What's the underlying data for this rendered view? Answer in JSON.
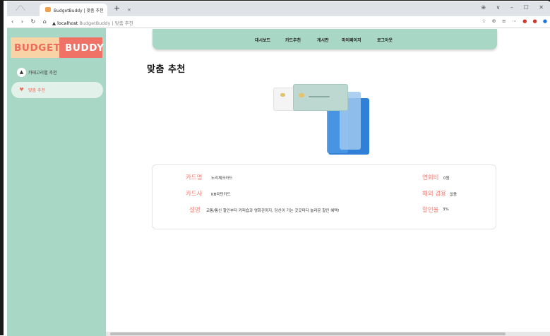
{
  "browser": {
    "tab_title": "BudgetBuddy | 맞춤 추천",
    "tab_close": "×",
    "new_tab": "+",
    "window_controls": "⊕ ∨ – ☐ ✕",
    "nav_buttons": "‹ › ↻ ⌂",
    "url_host": "localhost",
    "url_rest": "BudgetBuddy | 맞춤 추천",
    "toolbar_icons": "☆ ⊕ ≡ ⋯"
  },
  "sidebar": {
    "brand_part1": "BUDGET",
    "brand_part2": "BUDDY",
    "items": [
      {
        "label": "카테고리별 추천",
        "icon": "category-icon"
      },
      {
        "label": "맞춤 추천",
        "icon": "heart-icon"
      }
    ]
  },
  "topnav": {
    "items": [
      "대시보드",
      "카드추천",
      "게시판",
      "마이페이지",
      "로그아웃"
    ]
  },
  "main": {
    "title": "맞춤 추천"
  },
  "card_info": {
    "name_label": "카드명",
    "name_value": "노리체크카드",
    "company_label": "카드사",
    "company_value": "KB국민카드",
    "desc_label": "설명",
    "desc_value": "교통/통신 할인부터 커피숍과 영화관까지, 당신이 가는 곳곳마다 놀라운 할인 혜택!",
    "annual_fee_label": "연회비",
    "annual_fee_value": "0원",
    "overseas_label": "해외 겸용",
    "overseas_value": "없음",
    "discount_label": "할인율",
    "discount_value": "3%"
  },
  "colors": {
    "mint": "#a9d7c5",
    "coral": "#f07166",
    "peach": "#f7d3a5",
    "label_red": "#ef7d74"
  }
}
